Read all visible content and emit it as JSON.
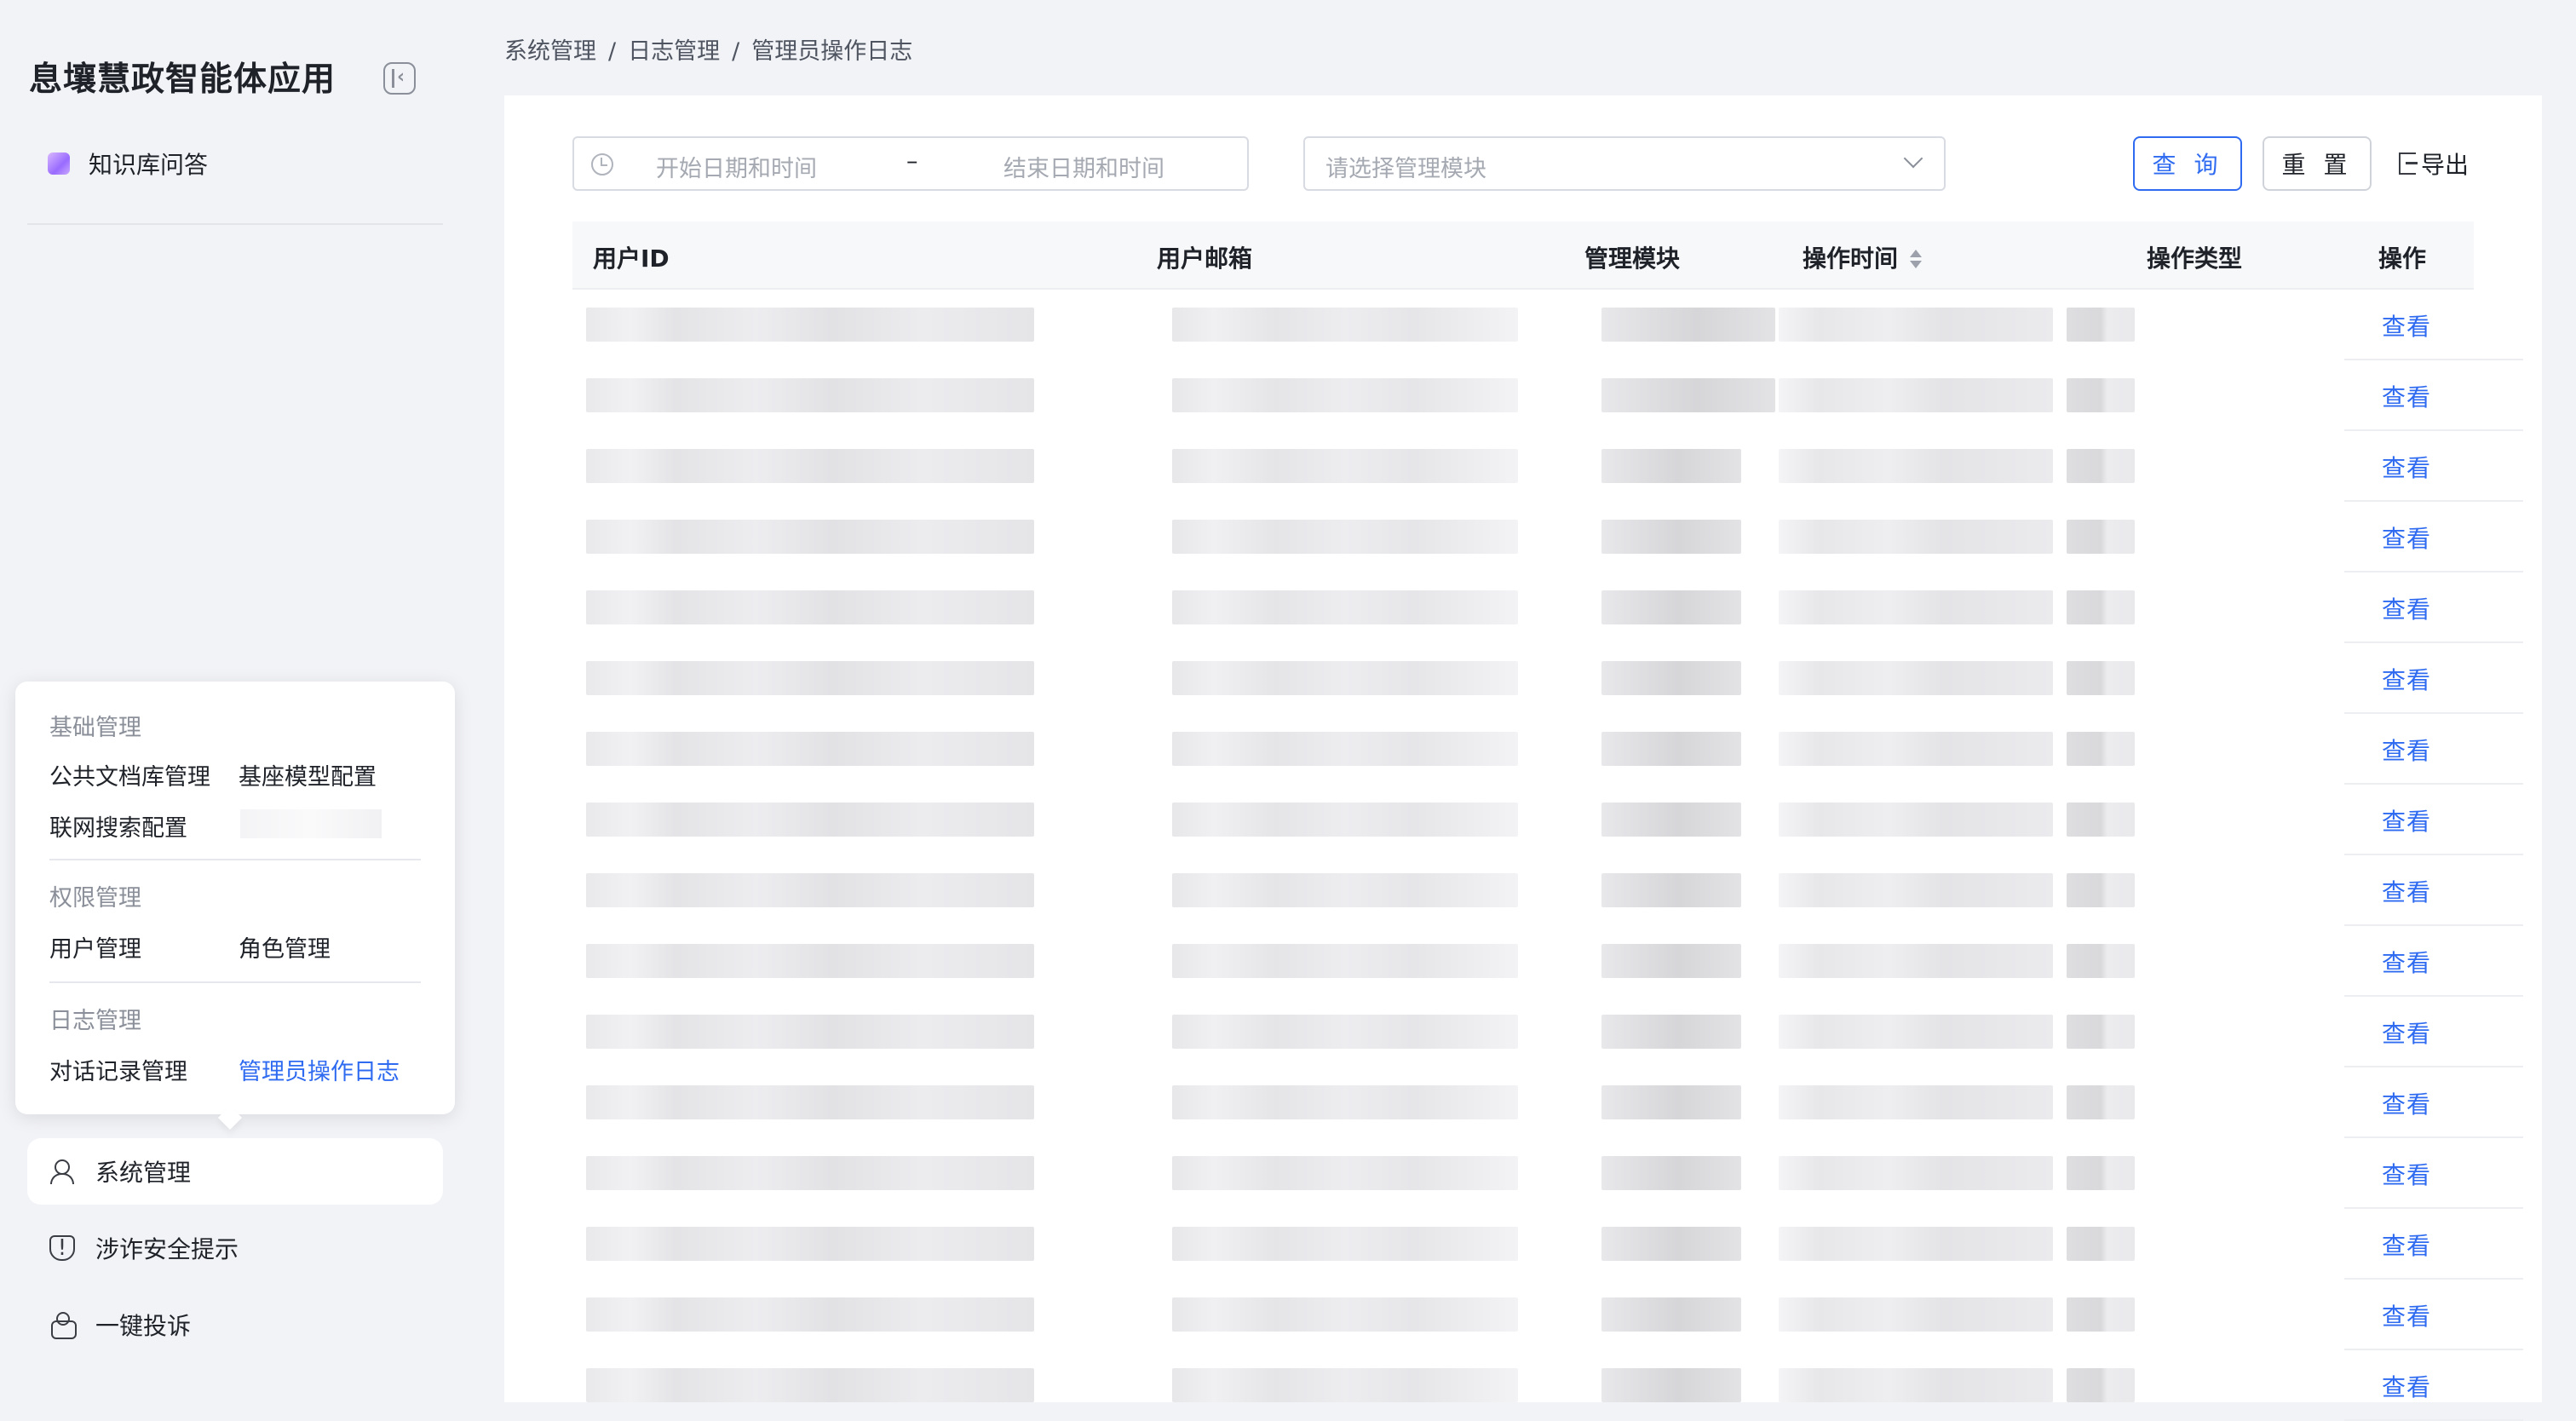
{
  "app": {
    "title": "息壤慧政智能体应用",
    "collapse_icon": "collapse-panel-icon"
  },
  "sidebar": {
    "kb_item": {
      "label": "知识库问答",
      "icon": "knowledge-base-icon"
    },
    "popover": {
      "sections": [
        {
          "title": "基础管理",
          "links": [
            "公共文档库管理",
            "基座模型配置",
            "联网搜索配置"
          ]
        },
        {
          "title": "权限管理",
          "links": [
            "用户管理",
            "角色管理"
          ]
        },
        {
          "title": "日志管理",
          "links": [
            "对话记录管理",
            "管理员操作日志"
          ]
        }
      ],
      "active_link": "管理员操作日志"
    },
    "nav": [
      {
        "label": "系统管理",
        "icon": "user-settings-icon",
        "selected": true
      },
      {
        "label": "涉诈安全提示",
        "icon": "shield-icon",
        "selected": false
      },
      {
        "label": "一键投诉",
        "icon": "complaint-icon",
        "selected": false
      }
    ]
  },
  "breadcrumb": [
    "系统管理",
    "日志管理",
    "管理员操作日志"
  ],
  "filters": {
    "date_start_placeholder": "开始日期和时间",
    "date_separator": "–",
    "date_end_placeholder": "结束日期和时间",
    "module_placeholder": "请选择管理模块",
    "query_label": "查 询",
    "reset_label": "重 置",
    "export_label": "导出"
  },
  "table": {
    "columns": [
      "用户ID",
      "用户邮箱",
      "管理模块",
      "操作时间",
      "操作类型",
      "操作"
    ],
    "sortable_column": "操作时间",
    "row_action": "查看",
    "row_count_visible": 16
  },
  "colors": {
    "accent": "#2f6bf0",
    "background": "#f2f3f7"
  }
}
